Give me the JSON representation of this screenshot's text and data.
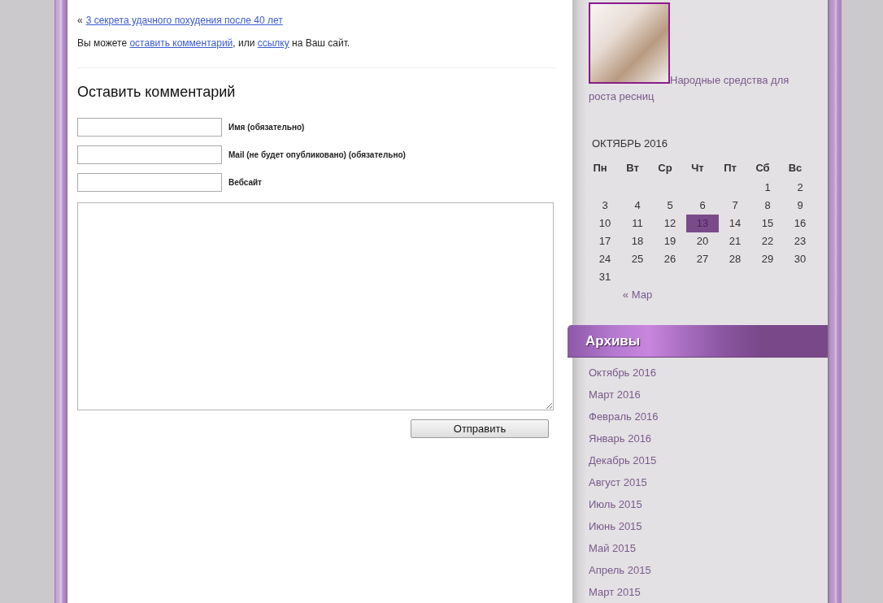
{
  "post_navigation": {
    "arrow": "«",
    "link": "3 секрета удачного похудения после 40 лет"
  },
  "comment_note": {
    "parts": [
      {
        "kind": "text",
        "text": "Вы можете "
      },
      {
        "kind": "link",
        "text": "оставить комментарий"
      },
      {
        "kind": "text",
        "text": ", или "
      },
      {
        "kind": "link",
        "text": "ссылку"
      },
      {
        "kind": "text",
        "text": " на Ваш сайт."
      }
    ]
  },
  "comment_form": {
    "title": "Оставить комментарий",
    "fields": [
      {
        "label": "Имя (обязательно)"
      },
      {
        "label": "Mail (не будет опубликовано) (обязательно)"
      },
      {
        "label": "Вебсайт"
      }
    ],
    "submit": "Отправить"
  },
  "sidebar": {
    "featured_post": {
      "title": "Народные средства для роста ресниц"
    },
    "calendar": {
      "caption": "ОКТЯБРЬ 2016",
      "weekdays": [
        "Пн",
        "Вт",
        "Ср",
        "Чт",
        "Пт",
        "Сб",
        "Вс"
      ],
      "weeks": [
        [
          {
            "day": "1",
            "today": false
          },
          {
            "day": "2",
            "today": false
          }
        ],
        [
          {
            "day": "3",
            "today": false
          },
          {
            "day": "4",
            "today": false
          },
          {
            "day": "5",
            "today": false
          },
          {
            "day": "6",
            "today": false
          },
          {
            "day": "7",
            "today": false
          },
          {
            "day": "8",
            "today": false
          },
          {
            "day": "9",
            "today": false
          }
        ],
        [
          {
            "day": "10",
            "today": false
          },
          {
            "day": "11",
            "today": false
          },
          {
            "day": "12",
            "today": false
          },
          {
            "day": "13",
            "today": true
          },
          {
            "day": "14",
            "today": false
          },
          {
            "day": "15",
            "today": false
          },
          {
            "day": "16",
            "today": false
          }
        ],
        [
          {
            "day": "17",
            "today": false
          },
          {
            "day": "18",
            "today": false
          },
          {
            "day": "19",
            "today": false
          },
          {
            "day": "20",
            "today": false
          },
          {
            "day": "21",
            "today": false
          },
          {
            "day": "22",
            "today": false
          },
          {
            "day": "23",
            "today": false
          }
        ],
        [
          {
            "day": "24",
            "today": false
          },
          {
            "day": "25",
            "today": false
          },
          {
            "day": "26",
            "today": false
          },
          {
            "day": "27",
            "today": false
          },
          {
            "day": "28",
            "today": false
          },
          {
            "day": "29",
            "today": false
          },
          {
            "day": "30",
            "today": false
          }
        ],
        [
          {
            "day": "31",
            "today": false
          }
        ]
      ],
      "previous_link": "« Мар"
    },
    "archives": {
      "title": "Архивы",
      "items": [
        "Октябрь 2016",
        "Март 2016",
        "Февраль 2016",
        "Январь 2016",
        "Декабрь 2015",
        "Август 2015",
        "Июль 2015",
        "Июнь 2015",
        "Май 2015",
        "Апрель 2015",
        "Март 2015"
      ]
    }
  }
}
